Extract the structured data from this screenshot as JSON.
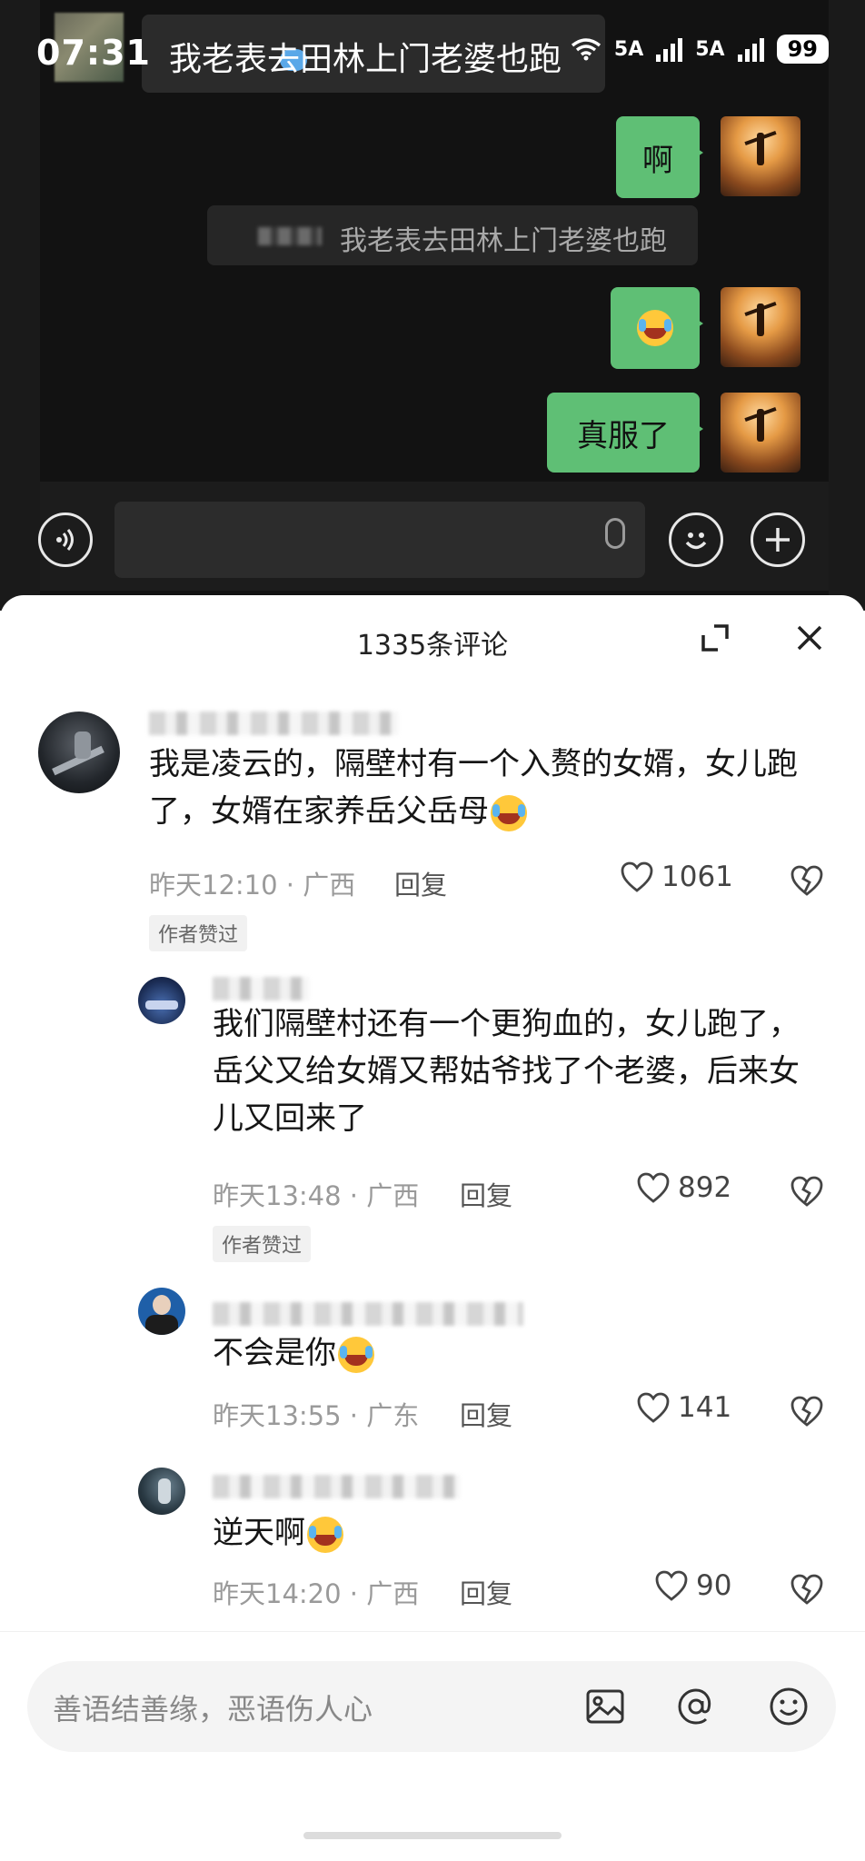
{
  "status_bar": {
    "time": "07:31",
    "network_1": "5A",
    "network_2": "5A",
    "battery": "99"
  },
  "notification": {
    "text": "我老表去田林上门老婆也跑"
  },
  "chat": {
    "messages": [
      {
        "type": "text",
        "text": "啊"
      },
      {
        "type": "quote",
        "text": "我老表去田林上门老婆也跑"
      },
      {
        "type": "emoji",
        "emoji": "crying-laughing-emoji"
      },
      {
        "type": "text",
        "text": "真服了"
      }
    ]
  },
  "sheet": {
    "title": "1335条评论"
  },
  "comments": [
    {
      "text": "我是凌云的，隔壁村有一个入赘的女婿，女儿跑了，女婿在家养岳父岳母",
      "time_location": "昨天12:10 · 广西",
      "reply_label": "回复",
      "likes": "1061",
      "badge": "作者赞过"
    },
    {
      "text": "我们隔壁村还有一个更狗血的，女儿跑了，岳父又给女婿又帮姑爷找了个老婆，后来女儿又回来了",
      "time_location": "昨天13:48 · 广西",
      "reply_label": "回复",
      "likes": "892",
      "badge": "作者赞过"
    },
    {
      "text": "不会是你",
      "time_location": "昨天13:55 · 广东",
      "reply_label": "回复",
      "likes": "141"
    },
    {
      "text": "逆天啊",
      "time_location": "昨天14:20 · 广西",
      "reply_label": "回复",
      "likes": "90"
    }
  ],
  "input": {
    "placeholder": "善语结善缘，恶语伤人心"
  },
  "colors": {
    "bubble_green": "#5fbf75",
    "chat_bg": "#121212"
  }
}
